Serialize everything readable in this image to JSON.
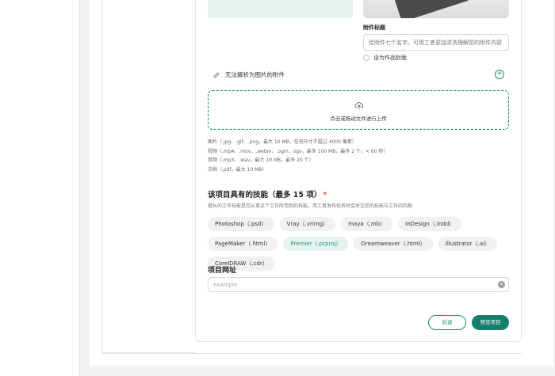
{
  "attachment": {
    "caption_label": "附件标题",
    "caption_placeholder": "给附件七个名字。可用工者更加清洗理解您的附件内容",
    "set_cover_label": "设为作品封面",
    "unparsed_label": "无法解析为图片的附件",
    "upload_prompt": "点击或拖动文件进行上传",
    "rules": [
      "图片（.jpg、.gif、.png，最大 10 MB，任何尺寸不超过 4000 像素）",
      "视频（.mp4、.mov、.webm、.ogm、ogv，最多 100 MB，最多 2 个，< 60 秒）",
      "音频（.mp3、.wav，最大 10 MB，最多 20 个）",
      "文档（.pdf，最大 10 MB）"
    ]
  },
  "skills": {
    "title": "该项目具有的技能（最多 15 项）",
    "required_mark": "*",
    "description": "擅长的工作技能是您从事这个工作所用到的技能。用工者发布任务时会关注您的技能与工作的匹配",
    "items": [
      {
        "label": "Photoshop（.psd）",
        "selected": false
      },
      {
        "label": "Vray（.vrimg）",
        "selected": false
      },
      {
        "label": "maya（.mb）",
        "selected": false
      },
      {
        "label": "InDesign（.indd）",
        "selected": false
      },
      {
        "label": "PageMaker（.html）",
        "selected": false
      },
      {
        "label": "Premier（.prproj）",
        "selected": true
      },
      {
        "label": "Dreamweaver（.html）",
        "selected": false
      },
      {
        "label": "Illustrator（.ai）",
        "selected": false
      },
      {
        "label": "CorelDRAW（.cdr）",
        "selected": false
      }
    ]
  },
  "project_url": {
    "title": "项目网址",
    "placeholder": "example",
    "value": ""
  },
  "actions": {
    "back_label": "后退",
    "preview_label": "预览项目"
  },
  "icons": {
    "unparsed": "link-icon",
    "add": "plus-circle-icon",
    "upload": "cloud-upload-icon",
    "clear": "clear-circle-icon"
  },
  "colors": {
    "accent": "#1a8f7a",
    "accent_dark": "#167f6c",
    "required": "#e0622f",
    "selected_chip_bg": "#e6f4f1"
  }
}
